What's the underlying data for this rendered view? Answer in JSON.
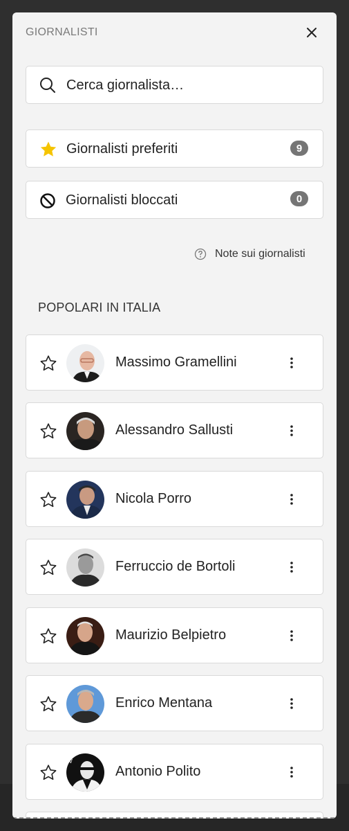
{
  "panel": {
    "title": "GIORNALISTI",
    "close_icon": "close-icon"
  },
  "search": {
    "placeholder": "Cerca giornalista…",
    "icon": "search-icon"
  },
  "favorites": {
    "label": "Giornalisti preferiti",
    "count": "9",
    "icon": "star-filled-icon",
    "icon_color": "#f5c400"
  },
  "blocked": {
    "label": "Giornalisti bloccati",
    "count": "0",
    "icon": "block-icon"
  },
  "notes_link": {
    "label": "Note sui giornalisti",
    "icon": "help-circle-icon"
  },
  "section": {
    "title": "POPOLARI IN ITALIA"
  },
  "journalists": [
    {
      "name": "Massimo Gramellini"
    },
    {
      "name": "Alessandro Sallusti"
    },
    {
      "name": "Nicola Porro"
    },
    {
      "name": "Ferruccio de Bortoli"
    },
    {
      "name": "Maurizio Belpietro"
    },
    {
      "name": "Enrico Mentana"
    },
    {
      "name": "Antonio Polito"
    }
  ],
  "colors": {
    "panel_bg": "#f3f3f3",
    "backdrop": "#2f2f2f",
    "badge_bg": "#757575",
    "star_gold": "#f5c400"
  }
}
